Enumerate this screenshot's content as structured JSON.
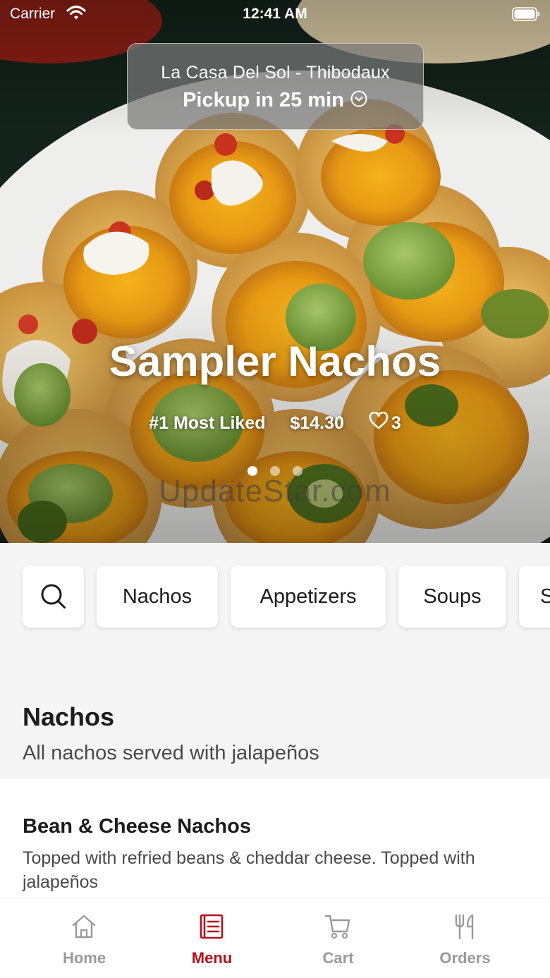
{
  "status_bar": {
    "carrier": "Carrier",
    "time": "12:41 AM",
    "wifi_icon": "wifi-icon",
    "battery_icon": "battery-icon"
  },
  "pickup": {
    "restaurant": "La Casa Del Sol - Thibodaux",
    "time_label": "Pickup in 25 min",
    "icon": "chevron-down-circle-icon"
  },
  "featured": {
    "title": "Sampler Nachos",
    "rank": "#1 Most Liked",
    "price": "$14.30",
    "likes": "3",
    "like_icon": "heart-icon",
    "carousel_pages": 3,
    "carousel_active_index": 0
  },
  "watermark": "UpdateStar.com",
  "categories": {
    "search_icon": "search-icon",
    "items": [
      "Nachos",
      "Appetizers",
      "Soups",
      "S"
    ]
  },
  "section": {
    "title": "Nachos",
    "subtitle": "All nachos served with jalapeños",
    "items": [
      {
        "name": "Bean & Cheese Nachos",
        "description": "Topped with refried beans & cheddar cheese. Topped with jalapeños"
      }
    ]
  },
  "tab_bar": {
    "active_tab": "Menu",
    "accent_color": "#b3121c",
    "inactive_color": "#9a9a9a",
    "tabs": [
      {
        "label": "Home",
        "icon": "home-icon"
      },
      {
        "label": "Menu",
        "icon": "menu-icon"
      },
      {
        "label": "Cart",
        "icon": "cart-icon"
      },
      {
        "label": "Orders",
        "icon": "fork-knife-icon"
      }
    ]
  }
}
